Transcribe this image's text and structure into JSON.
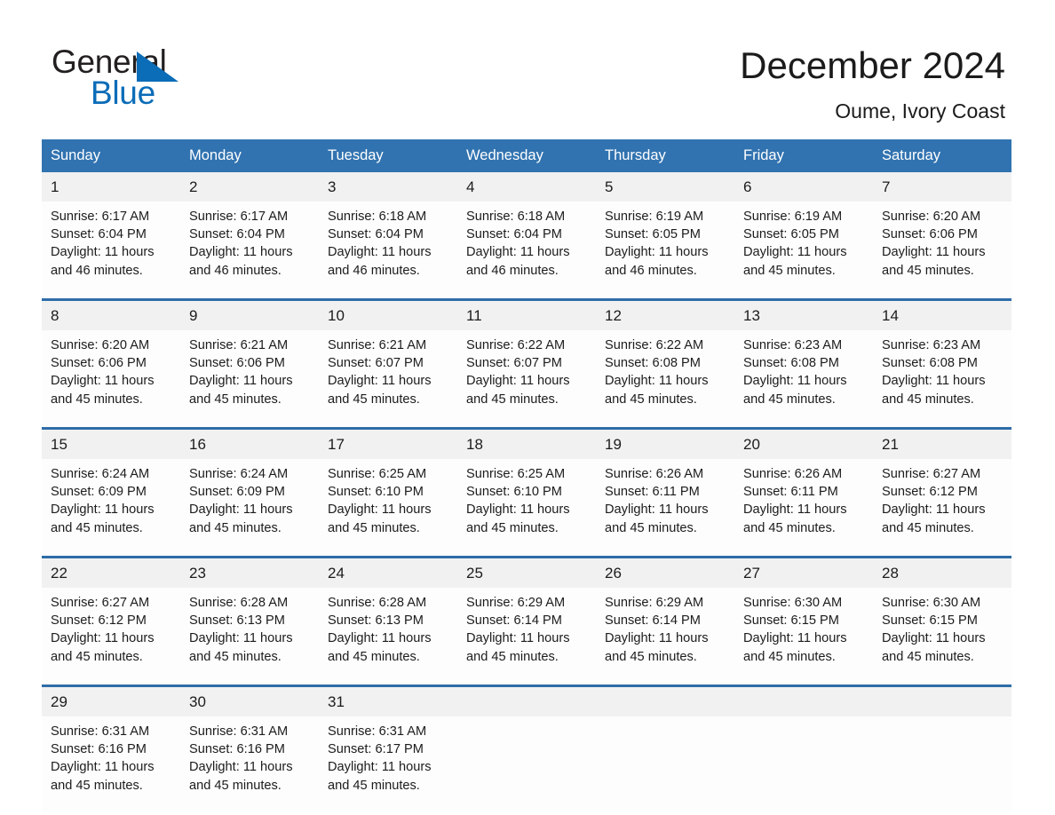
{
  "brand": {
    "name_part1": "General",
    "name_part2": "Blue",
    "triangle_color": "#0b6cb7",
    "logo_icon": "triangle-logo-icon"
  },
  "header": {
    "title": "December 2024",
    "subtitle": "Oume, Ivory Coast"
  },
  "theme": {
    "header_blue": "#3173b0",
    "separator_blue": "#2e6da8",
    "daynum_band": "#f1f1f1",
    "cell_bg": "#fdfdfd",
    "text": "#1c1c1c"
  },
  "calendar": {
    "weekday_headers": [
      "Sunday",
      "Monday",
      "Tuesday",
      "Wednesday",
      "Thursday",
      "Friday",
      "Saturday"
    ],
    "weeks": [
      [
        {
          "day": "1",
          "sunrise": "Sunrise: 6:17 AM",
          "sunset": "Sunset: 6:04 PM",
          "daylight_l1": "Daylight: 11 hours",
          "daylight_l2": "and 46 minutes."
        },
        {
          "day": "2",
          "sunrise": "Sunrise: 6:17 AM",
          "sunset": "Sunset: 6:04 PM",
          "daylight_l1": "Daylight: 11 hours",
          "daylight_l2": "and 46 minutes."
        },
        {
          "day": "3",
          "sunrise": "Sunrise: 6:18 AM",
          "sunset": "Sunset: 6:04 PM",
          "daylight_l1": "Daylight: 11 hours",
          "daylight_l2": "and 46 minutes."
        },
        {
          "day": "4",
          "sunrise": "Sunrise: 6:18 AM",
          "sunset": "Sunset: 6:04 PM",
          "daylight_l1": "Daylight: 11 hours",
          "daylight_l2": "and 46 minutes."
        },
        {
          "day": "5",
          "sunrise": "Sunrise: 6:19 AM",
          "sunset": "Sunset: 6:05 PM",
          "daylight_l1": "Daylight: 11 hours",
          "daylight_l2": "and 46 minutes."
        },
        {
          "day": "6",
          "sunrise": "Sunrise: 6:19 AM",
          "sunset": "Sunset: 6:05 PM",
          "daylight_l1": "Daylight: 11 hours",
          "daylight_l2": "and 45 minutes."
        },
        {
          "day": "7",
          "sunrise": "Sunrise: 6:20 AM",
          "sunset": "Sunset: 6:06 PM",
          "daylight_l1": "Daylight: 11 hours",
          "daylight_l2": "and 45 minutes."
        }
      ],
      [
        {
          "day": "8",
          "sunrise": "Sunrise: 6:20 AM",
          "sunset": "Sunset: 6:06 PM",
          "daylight_l1": "Daylight: 11 hours",
          "daylight_l2": "and 45 minutes."
        },
        {
          "day": "9",
          "sunrise": "Sunrise: 6:21 AM",
          "sunset": "Sunset: 6:06 PM",
          "daylight_l1": "Daylight: 11 hours",
          "daylight_l2": "and 45 minutes."
        },
        {
          "day": "10",
          "sunrise": "Sunrise: 6:21 AM",
          "sunset": "Sunset: 6:07 PM",
          "daylight_l1": "Daylight: 11 hours",
          "daylight_l2": "and 45 minutes."
        },
        {
          "day": "11",
          "sunrise": "Sunrise: 6:22 AM",
          "sunset": "Sunset: 6:07 PM",
          "daylight_l1": "Daylight: 11 hours",
          "daylight_l2": "and 45 minutes."
        },
        {
          "day": "12",
          "sunrise": "Sunrise: 6:22 AM",
          "sunset": "Sunset: 6:08 PM",
          "daylight_l1": "Daylight: 11 hours",
          "daylight_l2": "and 45 minutes."
        },
        {
          "day": "13",
          "sunrise": "Sunrise: 6:23 AM",
          "sunset": "Sunset: 6:08 PM",
          "daylight_l1": "Daylight: 11 hours",
          "daylight_l2": "and 45 minutes."
        },
        {
          "day": "14",
          "sunrise": "Sunrise: 6:23 AM",
          "sunset": "Sunset: 6:08 PM",
          "daylight_l1": "Daylight: 11 hours",
          "daylight_l2": "and 45 minutes."
        }
      ],
      [
        {
          "day": "15",
          "sunrise": "Sunrise: 6:24 AM",
          "sunset": "Sunset: 6:09 PM",
          "daylight_l1": "Daylight: 11 hours",
          "daylight_l2": "and 45 minutes."
        },
        {
          "day": "16",
          "sunrise": "Sunrise: 6:24 AM",
          "sunset": "Sunset: 6:09 PM",
          "daylight_l1": "Daylight: 11 hours",
          "daylight_l2": "and 45 minutes."
        },
        {
          "day": "17",
          "sunrise": "Sunrise: 6:25 AM",
          "sunset": "Sunset: 6:10 PM",
          "daylight_l1": "Daylight: 11 hours",
          "daylight_l2": "and 45 minutes."
        },
        {
          "day": "18",
          "sunrise": "Sunrise: 6:25 AM",
          "sunset": "Sunset: 6:10 PM",
          "daylight_l1": "Daylight: 11 hours",
          "daylight_l2": "and 45 minutes."
        },
        {
          "day": "19",
          "sunrise": "Sunrise: 6:26 AM",
          "sunset": "Sunset: 6:11 PM",
          "daylight_l1": "Daylight: 11 hours",
          "daylight_l2": "and 45 minutes."
        },
        {
          "day": "20",
          "sunrise": "Sunrise: 6:26 AM",
          "sunset": "Sunset: 6:11 PM",
          "daylight_l1": "Daylight: 11 hours",
          "daylight_l2": "and 45 minutes."
        },
        {
          "day": "21",
          "sunrise": "Sunrise: 6:27 AM",
          "sunset": "Sunset: 6:12 PM",
          "daylight_l1": "Daylight: 11 hours",
          "daylight_l2": "and 45 minutes."
        }
      ],
      [
        {
          "day": "22",
          "sunrise": "Sunrise: 6:27 AM",
          "sunset": "Sunset: 6:12 PM",
          "daylight_l1": "Daylight: 11 hours",
          "daylight_l2": "and 45 minutes."
        },
        {
          "day": "23",
          "sunrise": "Sunrise: 6:28 AM",
          "sunset": "Sunset: 6:13 PM",
          "daylight_l1": "Daylight: 11 hours",
          "daylight_l2": "and 45 minutes."
        },
        {
          "day": "24",
          "sunrise": "Sunrise: 6:28 AM",
          "sunset": "Sunset: 6:13 PM",
          "daylight_l1": "Daylight: 11 hours",
          "daylight_l2": "and 45 minutes."
        },
        {
          "day": "25",
          "sunrise": "Sunrise: 6:29 AM",
          "sunset": "Sunset: 6:14 PM",
          "daylight_l1": "Daylight: 11 hours",
          "daylight_l2": "and 45 minutes."
        },
        {
          "day": "26",
          "sunrise": "Sunrise: 6:29 AM",
          "sunset": "Sunset: 6:14 PM",
          "daylight_l1": "Daylight: 11 hours",
          "daylight_l2": "and 45 minutes."
        },
        {
          "day": "27",
          "sunrise": "Sunrise: 6:30 AM",
          "sunset": "Sunset: 6:15 PM",
          "daylight_l1": "Daylight: 11 hours",
          "daylight_l2": "and 45 minutes."
        },
        {
          "day": "28",
          "sunrise": "Sunrise: 6:30 AM",
          "sunset": "Sunset: 6:15 PM",
          "daylight_l1": "Daylight: 11 hours",
          "daylight_l2": "and 45 minutes."
        }
      ],
      [
        {
          "day": "29",
          "sunrise": "Sunrise: 6:31 AM",
          "sunset": "Sunset: 6:16 PM",
          "daylight_l1": "Daylight: 11 hours",
          "daylight_l2": "and 45 minutes."
        },
        {
          "day": "30",
          "sunrise": "Sunrise: 6:31 AM",
          "sunset": "Sunset: 6:16 PM",
          "daylight_l1": "Daylight: 11 hours",
          "daylight_l2": "and 45 minutes."
        },
        {
          "day": "31",
          "sunrise": "Sunrise: 6:31 AM",
          "sunset": "Sunset: 6:17 PM",
          "daylight_l1": "Daylight: 11 hours",
          "daylight_l2": "and 45 minutes."
        },
        {
          "day": "",
          "sunrise": "",
          "sunset": "",
          "daylight_l1": "",
          "daylight_l2": ""
        },
        {
          "day": "",
          "sunrise": "",
          "sunset": "",
          "daylight_l1": "",
          "daylight_l2": ""
        },
        {
          "day": "",
          "sunrise": "",
          "sunset": "",
          "daylight_l1": "",
          "daylight_l2": ""
        },
        {
          "day": "",
          "sunrise": "",
          "sunset": "",
          "daylight_l1": "",
          "daylight_l2": ""
        }
      ]
    ]
  }
}
